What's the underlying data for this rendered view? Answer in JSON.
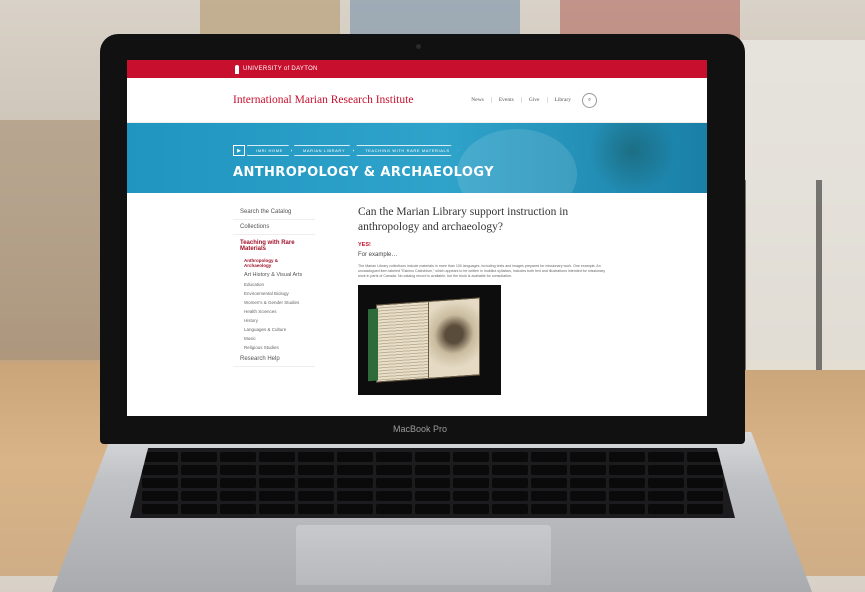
{
  "colors": {
    "brand_red": "#c8102e",
    "hero_blue": "#2fa3ca",
    "link_active": "#a0122a"
  },
  "device": {
    "label": "MacBook Pro"
  },
  "site": {
    "university": "UNIVERSITY of DAYTON",
    "title": "International Marian Research Institute",
    "nav": [
      "News",
      "Events",
      "Give",
      "Library"
    ]
  },
  "hero": {
    "breadcrumbs": [
      "IMRI HOME",
      "MARIAN LIBRARY",
      "TEACHING WITH RARE MATERIALS"
    ],
    "heading": "ANTHROPOLOGY & ARCHAEOLOGY"
  },
  "sidebar": {
    "items_top": [
      "Search the Catalog",
      "Collections"
    ],
    "active_section": "Teaching with Rare Materials",
    "sub_items": [
      "Anthropology & Archaeology",
      "Art History & Visual Arts",
      "Education",
      "Environmental Biology",
      "Women's & Gender Studies",
      "Health Sciences",
      "History",
      "Languages & Culture",
      "Music",
      "Religious Studies"
    ],
    "items_bottom": [
      "Research Help"
    ]
  },
  "main": {
    "question": "Can the Marian Library support instruction in anthropology and archaeology?",
    "answer": "YES!",
    "lead": "For example…",
    "body": "The Marian Library collections include materials in more than 100 languages, including texts and images prepared for missionary work. One example: An uncatalogued item labeled \"Eskimo Catechism,\" which appears to be written in Inuktitut syllabics, includes both text and illustrations intended for missionary work in parts of Canada. No catalog record is available, but the book is available for consultation."
  }
}
